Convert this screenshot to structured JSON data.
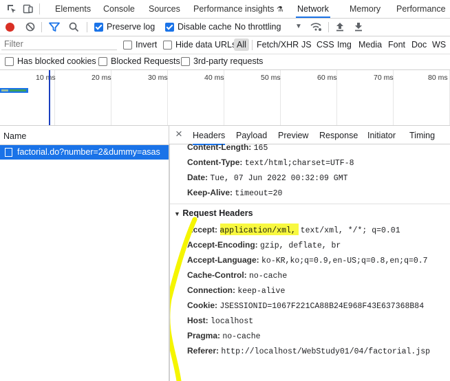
{
  "tabs": {
    "items": [
      {
        "label": "Elements"
      },
      {
        "label": "Console"
      },
      {
        "label": "Sources"
      },
      {
        "label": "Performance insights"
      },
      {
        "label": "Network"
      },
      {
        "label": "Memory"
      },
      {
        "label": "Performance"
      }
    ],
    "active": "Network"
  },
  "toolbar": {
    "preserve_log": "Preserve log",
    "disable_cache": "Disable cache",
    "throttling": "No throttling"
  },
  "filter": {
    "placeholder": "Filter",
    "invert": "Invert",
    "hide_data_urls": "Hide data URLs",
    "types": [
      "All",
      "Fetch/XHR",
      "JS",
      "CSS",
      "Img",
      "Media",
      "Font",
      "Doc",
      "WS"
    ]
  },
  "row3": {
    "blocked_cookies": "Has blocked cookies",
    "blocked_requests": "Blocked Requests",
    "third_party": "3rd-party requests"
  },
  "timeline": {
    "ticks": [
      "10 ms",
      "20 ms",
      "30 ms",
      "40 ms",
      "50 ms",
      "60 ms",
      "70 ms",
      "80 ms"
    ]
  },
  "requests": {
    "column_name": "Name",
    "items": [
      {
        "name": "factorial.do?number=2&dummy=asas"
      }
    ]
  },
  "details": {
    "close": "×",
    "tabs": [
      "Headers",
      "Payload",
      "Preview",
      "Response",
      "Initiator",
      "Timing"
    ],
    "response_headers": [
      {
        "key": "Content-Length:",
        "value": "165"
      },
      {
        "key": "Content-Type:",
        "value": "text/html;charset=UTF-8"
      },
      {
        "key": "Date:",
        "value": "Tue, 07 Jun 2022 00:32:09 GMT"
      },
      {
        "key": "Keep-Alive:",
        "value": "timeout=20"
      }
    ],
    "request_section_title": "Request Headers",
    "request_headers": [
      {
        "key": "Accept:",
        "value": "application/xml, text/xml, */*; q=0.01"
      },
      {
        "key": "Accept-Encoding:",
        "value": "gzip, deflate, br"
      },
      {
        "key": "Accept-Language:",
        "value": "ko-KR,ko;q=0.9,en-US;q=0.8,en;q=0.7"
      },
      {
        "key": "Cache-Control:",
        "value": "no-cache"
      },
      {
        "key": "Connection:",
        "value": "keep-alive"
      },
      {
        "key": "Cookie:",
        "value": "JSESSIONID=1067F221CA88B24E968F43E637368B84"
      },
      {
        "key": "Host:",
        "value": "localhost"
      },
      {
        "key": "Pragma:",
        "value": "no-cache"
      },
      {
        "key": "Referer:",
        "value": "http://localhost/WebStudy01/04/factorial.jsp"
      }
    ]
  },
  "colors": {
    "accent": "#1a73e8",
    "record": "#d93025",
    "highlight": "#f5f500"
  }
}
